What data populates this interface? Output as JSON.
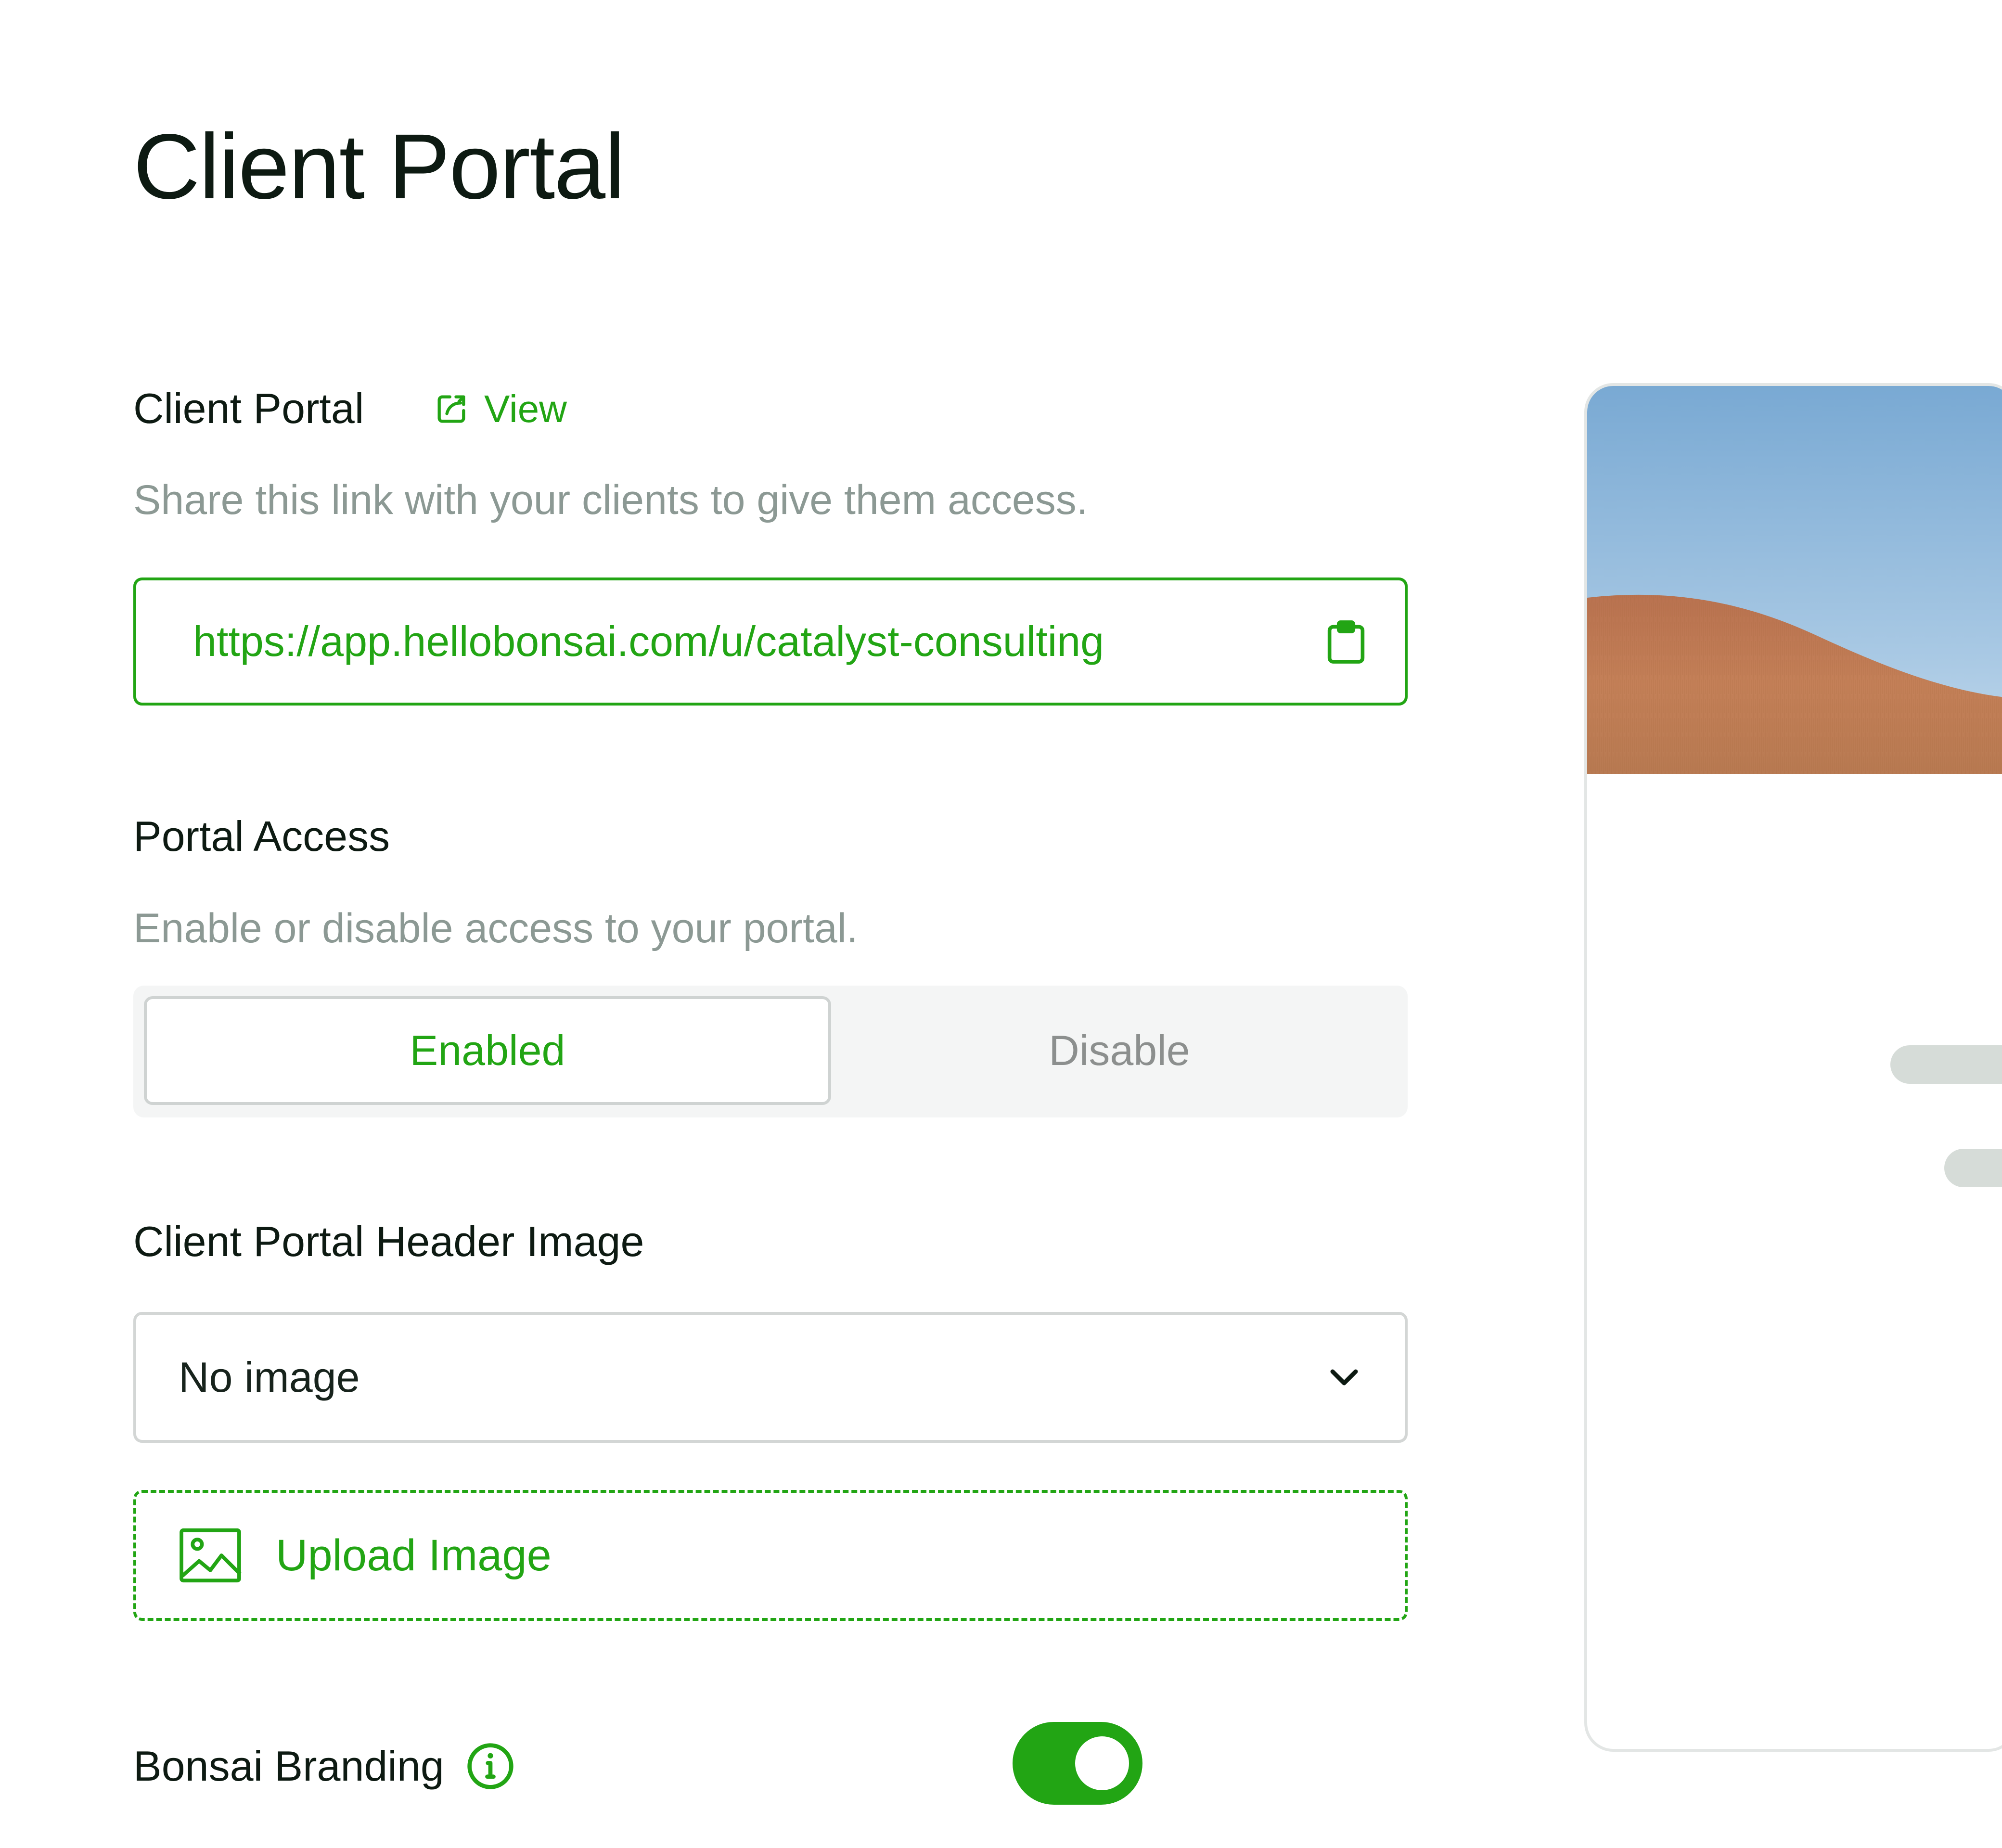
{
  "page": {
    "title": "Client Portal"
  },
  "client_portal": {
    "title": "Client Portal",
    "view_label": "View",
    "description": "Share this link with your clients to give them access.",
    "url": "https://app.hellobonsai.com/u/catalyst-consulting"
  },
  "portal_access": {
    "title": "Portal Access",
    "description": "Enable or disable access to your portal.",
    "options": [
      "Enabled",
      "Disable"
    ],
    "selected": "Enabled"
  },
  "header_image": {
    "title": "Client Portal Header Image",
    "selected": "No image",
    "upload_label": "Upload Image"
  },
  "branding": {
    "label": "Bonsai Branding",
    "enabled": true
  },
  "icons": {
    "view": "external-link-icon",
    "copy": "clipboard-icon",
    "select": "chevron-down-icon",
    "upload": "image-icon",
    "info": "info-icon"
  },
  "colors": {
    "accent": "#22a514",
    "muted_text": "#8c9994",
    "segment_bg": "#f4f5f5",
    "border": "#d3d6d5"
  }
}
